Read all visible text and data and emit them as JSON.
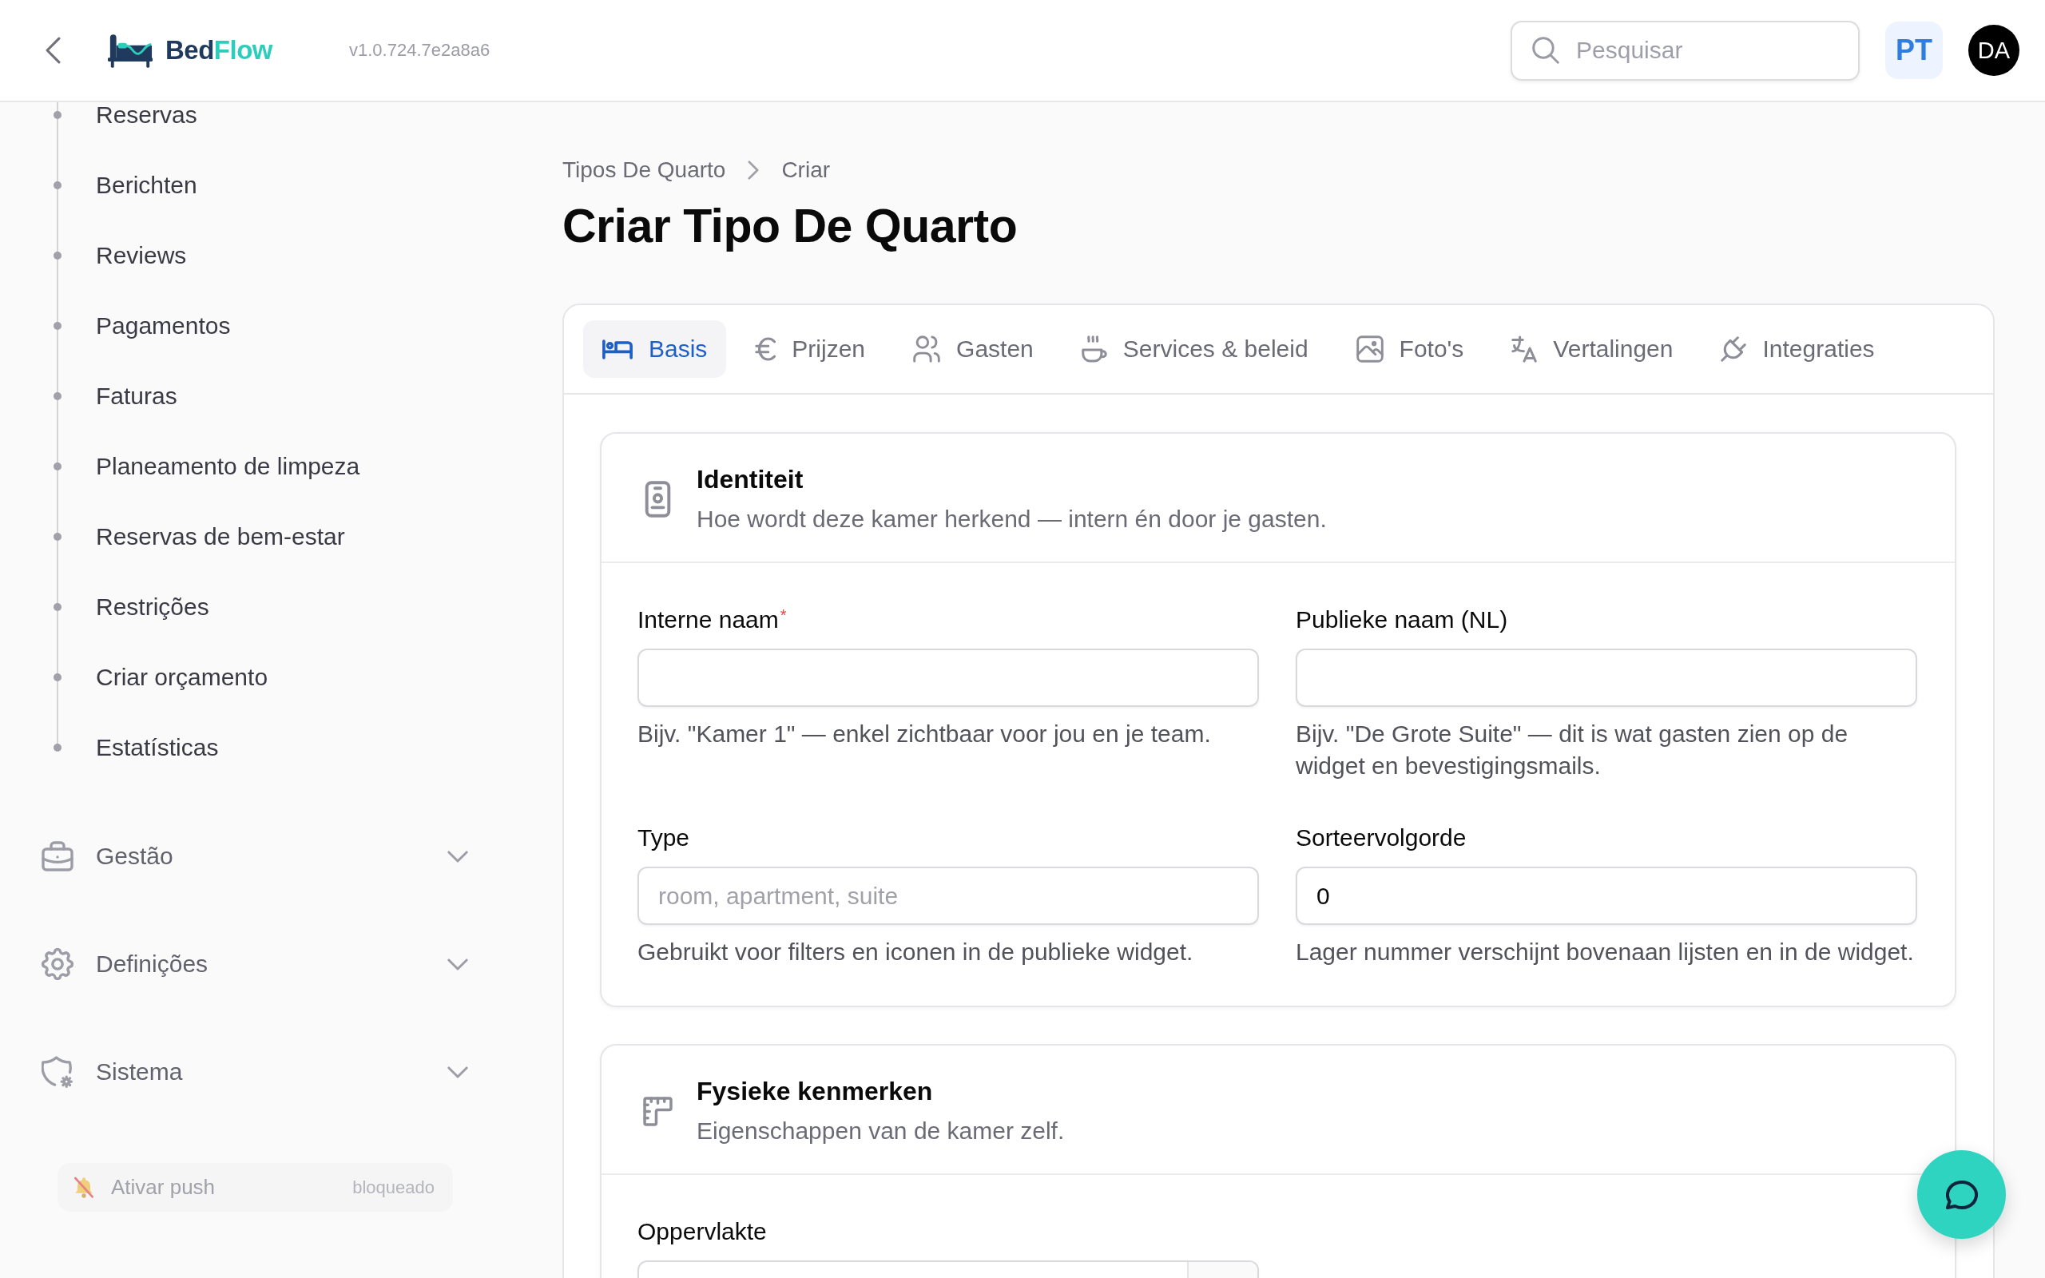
{
  "topbar": {
    "logo": {
      "primary": "Bed",
      "accent": "Flow"
    },
    "version": "v1.0.724.7e2a8a6",
    "search": {
      "placeholder": "Pesquisar"
    },
    "language": "PT",
    "avatar": "DA"
  },
  "sidebar": {
    "items": [
      {
        "label": "Reservas",
        "selected": false
      },
      {
        "label": "Berichten",
        "selected": false
      },
      {
        "label": "Reviews",
        "selected": false
      },
      {
        "label": "Pagamentos",
        "selected": false
      },
      {
        "label": "Faturas",
        "selected": false
      },
      {
        "label": "Planeamento de limpeza",
        "selected": false
      },
      {
        "label": "Reservas de bem-estar",
        "selected": false
      },
      {
        "label": "Restrições",
        "selected": false
      },
      {
        "label": "Criar orçamento",
        "selected": false
      },
      {
        "label": "Estatísticas",
        "selected": false
      }
    ],
    "groups": [
      {
        "label": "Gestão",
        "expanded": false
      },
      {
        "label": "Definições",
        "expanded": false
      },
      {
        "label": "Sistema",
        "expanded": false
      }
    ],
    "push": {
      "label": "Ativar push",
      "status": "bloqueado",
      "disabled": true
    }
  },
  "breadcrumb": [
    "Tipos De Quarto",
    "Criar"
  ],
  "title": "Criar Tipo De Quarto",
  "tabs": [
    {
      "label": "Basis",
      "selected": true
    },
    {
      "label": "Prijzen",
      "selected": false
    },
    {
      "label": "Gasten",
      "selected": false
    },
    {
      "label": "Services & beleid",
      "selected": false
    },
    {
      "label": "Foto's",
      "selected": false
    },
    {
      "label": "Vertalingen",
      "selected": false
    },
    {
      "label": "Integraties",
      "selected": false
    }
  ],
  "sections": [
    {
      "title": "Identiteit",
      "subtitle": "Hoe wordt deze kamer herkend — intern én door je gasten.",
      "fields": [
        {
          "kind": "text",
          "label": "Interne naam",
          "required_mark": "*",
          "help": "Bijv. \"Kamer 1\" — enkel zichtbaar voor jou en je team."
        },
        {
          "kind": "text",
          "label": "Publieke naam (NL)",
          "help": "Bijv. \"De Grote Suite\" — dit is wat gasten zien op de widget en bevestigingsmails."
        },
        {
          "kind": "text",
          "label": "Type",
          "placeholder": "room, apartment, suite",
          "help": "Gebruikt voor filters en iconen in de publieke widget."
        },
        {
          "kind": "text",
          "label": "Sorteervolgorde",
          "value": "0",
          "help": "Lager nummer verschijnt bovenaan lijsten en in de widget."
        }
      ]
    },
    {
      "title": "Fysieke kenmerken",
      "subtitle": "Eigenschappen van de kamer zelf.",
      "fields": [
        {
          "kind": "unit",
          "label": "Oppervlakte"
        }
      ]
    }
  ]
}
